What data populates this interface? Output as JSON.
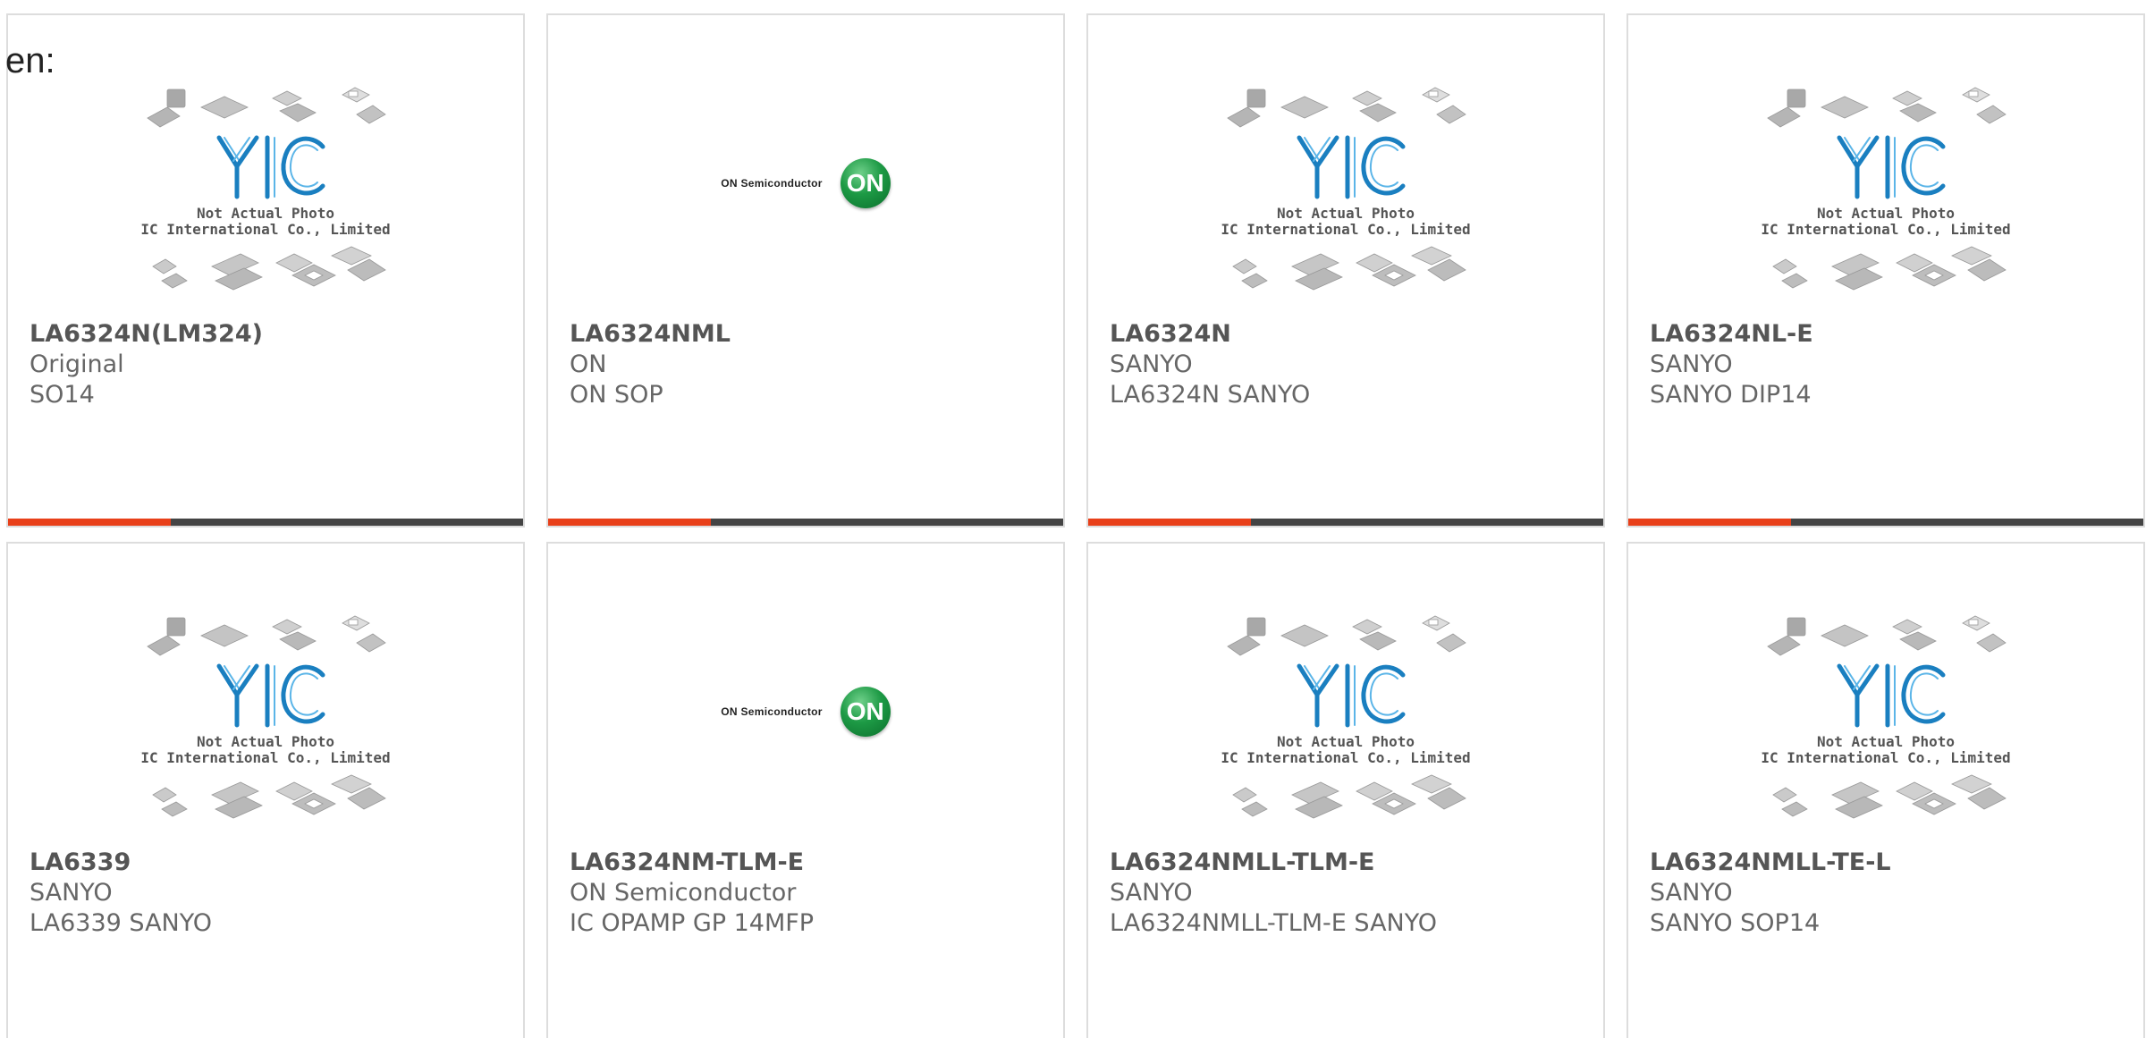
{
  "page": {
    "lang_label": "en:"
  },
  "colors": {
    "accent": "#e8401a",
    "bar": "#444444",
    "yic_blue": "#1a7fc0",
    "on_green": "#1d9a45"
  },
  "yic_placeholder": {
    "line1": "Not Actual Photo",
    "line2": "YIC International Co., Limited."
  },
  "on_logo": {
    "wordmark": "ON Semiconductor",
    "badge": "ON"
  },
  "products": [
    {
      "part": "LA6324N(LM324)",
      "brand": "Original",
      "desc": "SO14",
      "image": "yic-placeholder"
    },
    {
      "part": "LA6324NML",
      "brand": "ON",
      "desc": "ON SOP",
      "image": "on-semiconductor-logo"
    },
    {
      "part": "LA6324N",
      "brand": "SANYO",
      "desc": "LA6324N SANYO",
      "image": "yic-placeholder"
    },
    {
      "part": "LA6324NL-E",
      "brand": "SANYO",
      "desc": "SANYO DIP14",
      "image": "yic-placeholder"
    },
    {
      "part": "LA6339",
      "brand": "SANYO",
      "desc": "LA6339 SANYO",
      "image": "yic-placeholder"
    },
    {
      "part": "LA6324NM-TLM-E",
      "brand": "ON Semiconductor",
      "desc": "IC OPAMP GP 14MFP",
      "image": "on-semiconductor-logo"
    },
    {
      "part": "LA6324NMLL-TLM-E",
      "brand": "SANYO",
      "desc": "LA6324NMLL-TLM-E SANYO",
      "image": "yic-placeholder"
    },
    {
      "part": "LA6324NMLL-TE-L",
      "brand": "SANYO",
      "desc": "SANYO SOP14",
      "image": "yic-placeholder"
    }
  ]
}
